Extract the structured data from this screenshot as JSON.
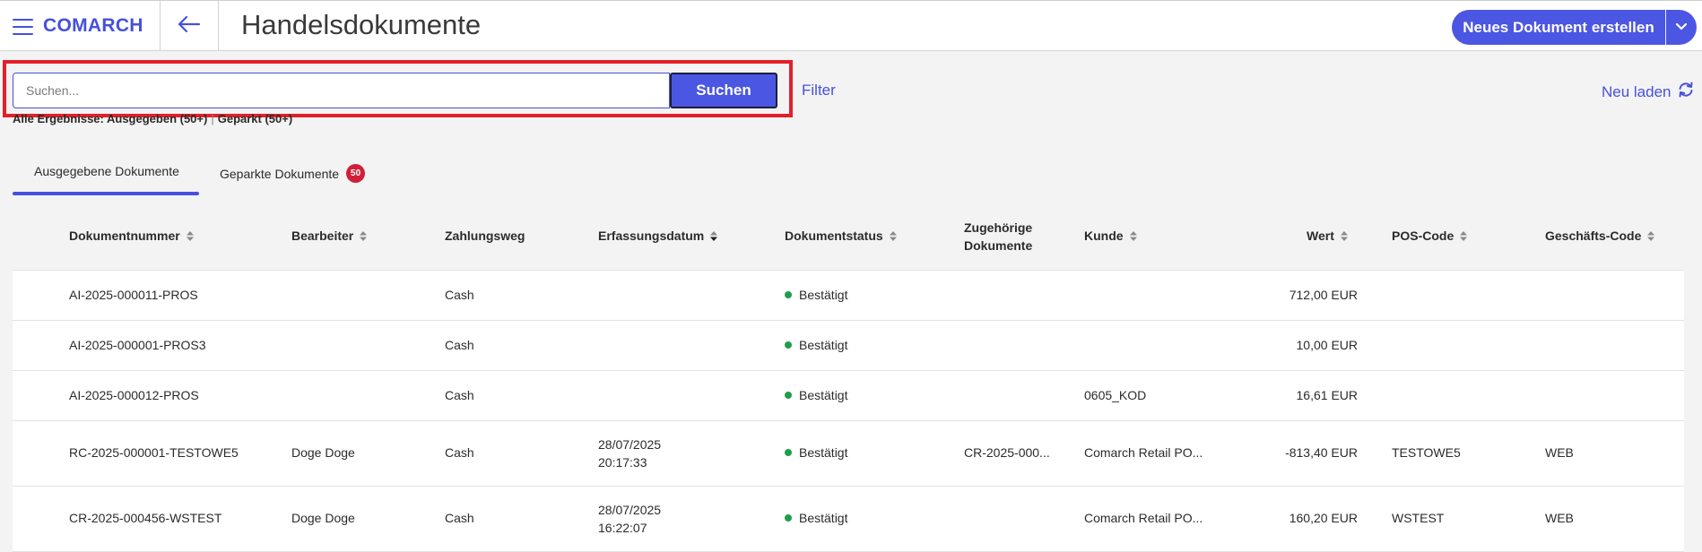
{
  "header": {
    "logo": "COMARCH",
    "title": "Handelsdokumente",
    "new_document_label": "Neues Dokument erstellen"
  },
  "search": {
    "placeholder": "Suchen...",
    "value": "",
    "button_label": "Suchen",
    "filter_label": "Filter",
    "reload_label": "Neu laden"
  },
  "results": {
    "prefix": "Alle Ergebnisse: Ausgegeben (50+)",
    "separator": "|",
    "parked": "Geparkt (50+)"
  },
  "tabs": [
    {
      "label": "Ausgegebene Dokumente",
      "active": true
    },
    {
      "label": "Geparkte Dokumente",
      "badge": "50"
    }
  ],
  "colors": {
    "accent": "#4b56e2",
    "highlight": "#e3202a",
    "badge": "#d11f3a",
    "status_confirmed": "#1f9d4a"
  },
  "table": {
    "columns": {
      "doc_number": "Dokumentnummer",
      "clerk": "Bearbeiter",
      "payment": "Zahlungsweg",
      "date": "Erfassungsdatum",
      "status": "Dokumentstatus",
      "related_line1": "Zugehörige",
      "related_line2": "Dokumente",
      "customer": "Kunde",
      "value": "Wert",
      "pos_code": "POS-Code",
      "business_code": "Geschäfts-Code"
    },
    "rows": [
      {
        "doc_number": "AI-2025-000011-PROS",
        "clerk": "",
        "payment": "Cash",
        "date_line1": "",
        "date_line2": "",
        "status": "Bestätigt",
        "related": "",
        "customer": "",
        "value": "712,00 EUR",
        "pos_code": "",
        "business_code": ""
      },
      {
        "doc_number": "AI-2025-000001-PROS3",
        "clerk": "",
        "payment": "Cash",
        "date_line1": "",
        "date_line2": "",
        "status": "Bestätigt",
        "related": "",
        "customer": "",
        "value": "10,00 EUR",
        "pos_code": "",
        "business_code": ""
      },
      {
        "doc_number": "AI-2025-000012-PROS",
        "clerk": "",
        "payment": "Cash",
        "date_line1": "",
        "date_line2": "",
        "status": "Bestätigt",
        "related": "",
        "customer": "0605_KOD",
        "value": "16,61 EUR",
        "pos_code": "",
        "business_code": ""
      },
      {
        "doc_number": "RC-2025-000001-TESTOWE5",
        "clerk": "Doge Doge",
        "payment": "Cash",
        "date_line1": "28/07/2025",
        "date_line2": "20:17:33",
        "status": "Bestätigt",
        "related": "CR-2025-000...",
        "customer": "Comarch Retail PO...",
        "value": "-813,40 EUR",
        "pos_code": "TESTOWE5",
        "business_code": "WEB"
      },
      {
        "doc_number": "CR-2025-000456-WSTEST",
        "clerk": "Doge Doge",
        "payment": "Cash",
        "date_line1": "28/07/2025",
        "date_line2": "16:22:07",
        "status": "Bestätigt",
        "related": "",
        "customer": "Comarch Retail PO...",
        "value": "160,20 EUR",
        "pos_code": "WSTEST",
        "business_code": "WEB"
      }
    ]
  }
}
